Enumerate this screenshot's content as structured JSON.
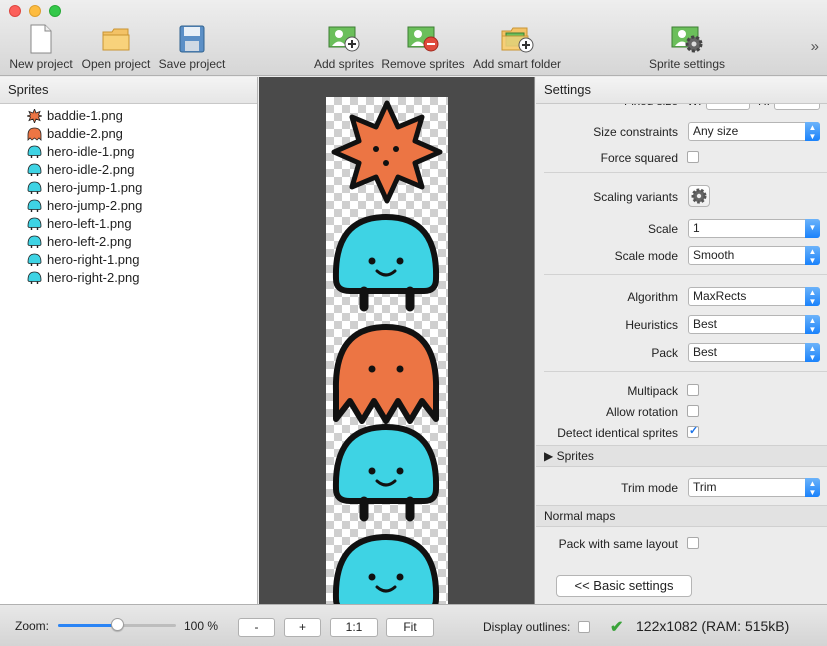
{
  "toolbar": {
    "new_project": "New project",
    "open_project": "Open project",
    "save_project": "Save project",
    "add_sprites": "Add sprites",
    "remove_sprites": "Remove sprites",
    "add_smart_folder": "Add smart folder",
    "sprite_settings": "Sprite settings",
    "overflow": "»"
  },
  "sprites_panel": {
    "title": "Sprites",
    "items": [
      {
        "name": "baddie-1.png",
        "icon": "baddie-star-icon"
      },
      {
        "name": "baddie-2.png",
        "icon": "baddie-ghost-icon"
      },
      {
        "name": "hero-idle-1.png",
        "icon": "hero-icon"
      },
      {
        "name": "hero-idle-2.png",
        "icon": "hero-icon"
      },
      {
        "name": "hero-jump-1.png",
        "icon": "hero-icon"
      },
      {
        "name": "hero-jump-2.png",
        "icon": "hero-icon"
      },
      {
        "name": "hero-left-1.png",
        "icon": "hero-icon"
      },
      {
        "name": "hero-left-2.png",
        "icon": "hero-icon"
      },
      {
        "name": "hero-right-1.png",
        "icon": "hero-icon"
      },
      {
        "name": "hero-right-2.png",
        "icon": "hero-icon"
      }
    ]
  },
  "settings": {
    "title": "Settings",
    "fixed_size_label": "Fixed size",
    "w_label": "W:",
    "h_label": "H:",
    "size_constraints_label": "Size constraints",
    "size_constraints_value": "Any size",
    "force_squared_label": "Force squared",
    "force_squared": false,
    "scaling_variants_label": "Scaling variants",
    "scale_label": "Scale",
    "scale_value": "1",
    "scale_mode_label": "Scale mode",
    "scale_mode_value": "Smooth",
    "algorithm_label": "Algorithm",
    "algorithm_value": "MaxRects",
    "heuristics_label": "Heuristics",
    "heuristics_value": "Best",
    "pack_label": "Pack",
    "pack_value": "Best",
    "multipack_label": "Multipack",
    "multipack": false,
    "allow_rotation_label": "Allow rotation",
    "allow_rotation": false,
    "detect_identical_label": "Detect identical sprites",
    "detect_identical": true,
    "sprites_section": "Sprites",
    "trim_mode_label": "Trim mode",
    "trim_mode_value": "Trim",
    "normal_maps_section": "Normal maps",
    "pack_same_layout_label": "Pack with same layout",
    "pack_same_layout": false,
    "basic_settings_button": "<< Basic settings"
  },
  "bottom_bar": {
    "zoom_label": "Zoom:",
    "zoom_value": "100 %",
    "zoom_fraction": 0.5,
    "minus": "-",
    "plus": "+",
    "one_to_one": "1:1",
    "fit": "Fit",
    "display_outlines_label": "Display outlines:",
    "display_outlines": false,
    "status": "122x1082 (RAM: 515kB)"
  },
  "colors": {
    "hero": "#3ed3e4",
    "baddie": "#ec7544",
    "accent": "#1a82fb"
  }
}
